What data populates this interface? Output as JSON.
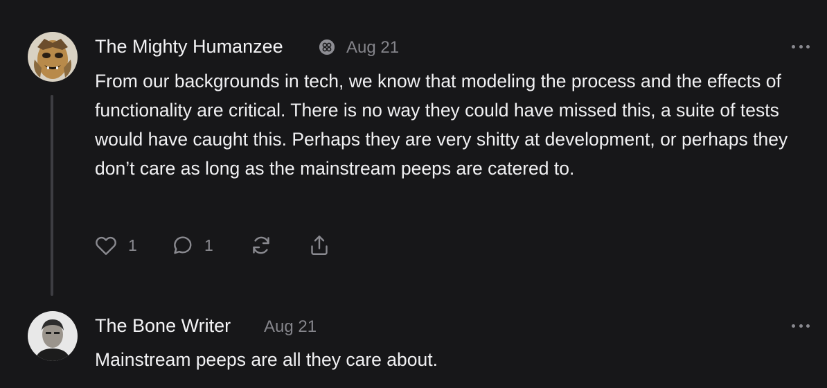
{
  "comments": [
    {
      "author": "The Mighty Humanzee",
      "date": "Aug 21",
      "body": "From our backgrounds in tech, we know that modeling the process and the effects of functionality are critical. There is no way they could have missed this, a suite of tests would have caught this. Perhaps they are very shitty at development, or perhaps they don’t care as long as the mainstream peeps are catered to.",
      "likes": "1",
      "replies": "1",
      "icons": [
        "heart-icon",
        "comment-icon",
        "restack-icon",
        "share-icon",
        "more-icon",
        "badge-icon"
      ]
    },
    {
      "author": "The Bone Writer",
      "date": "Aug 21",
      "body": "Mainstream peeps are all they care about.",
      "icons": [
        "more-icon"
      ]
    }
  ],
  "colors": {
    "background": "#171719",
    "text": "#f1f1f3",
    "muted": "#85858b",
    "thread_line": "#3d3d42"
  }
}
